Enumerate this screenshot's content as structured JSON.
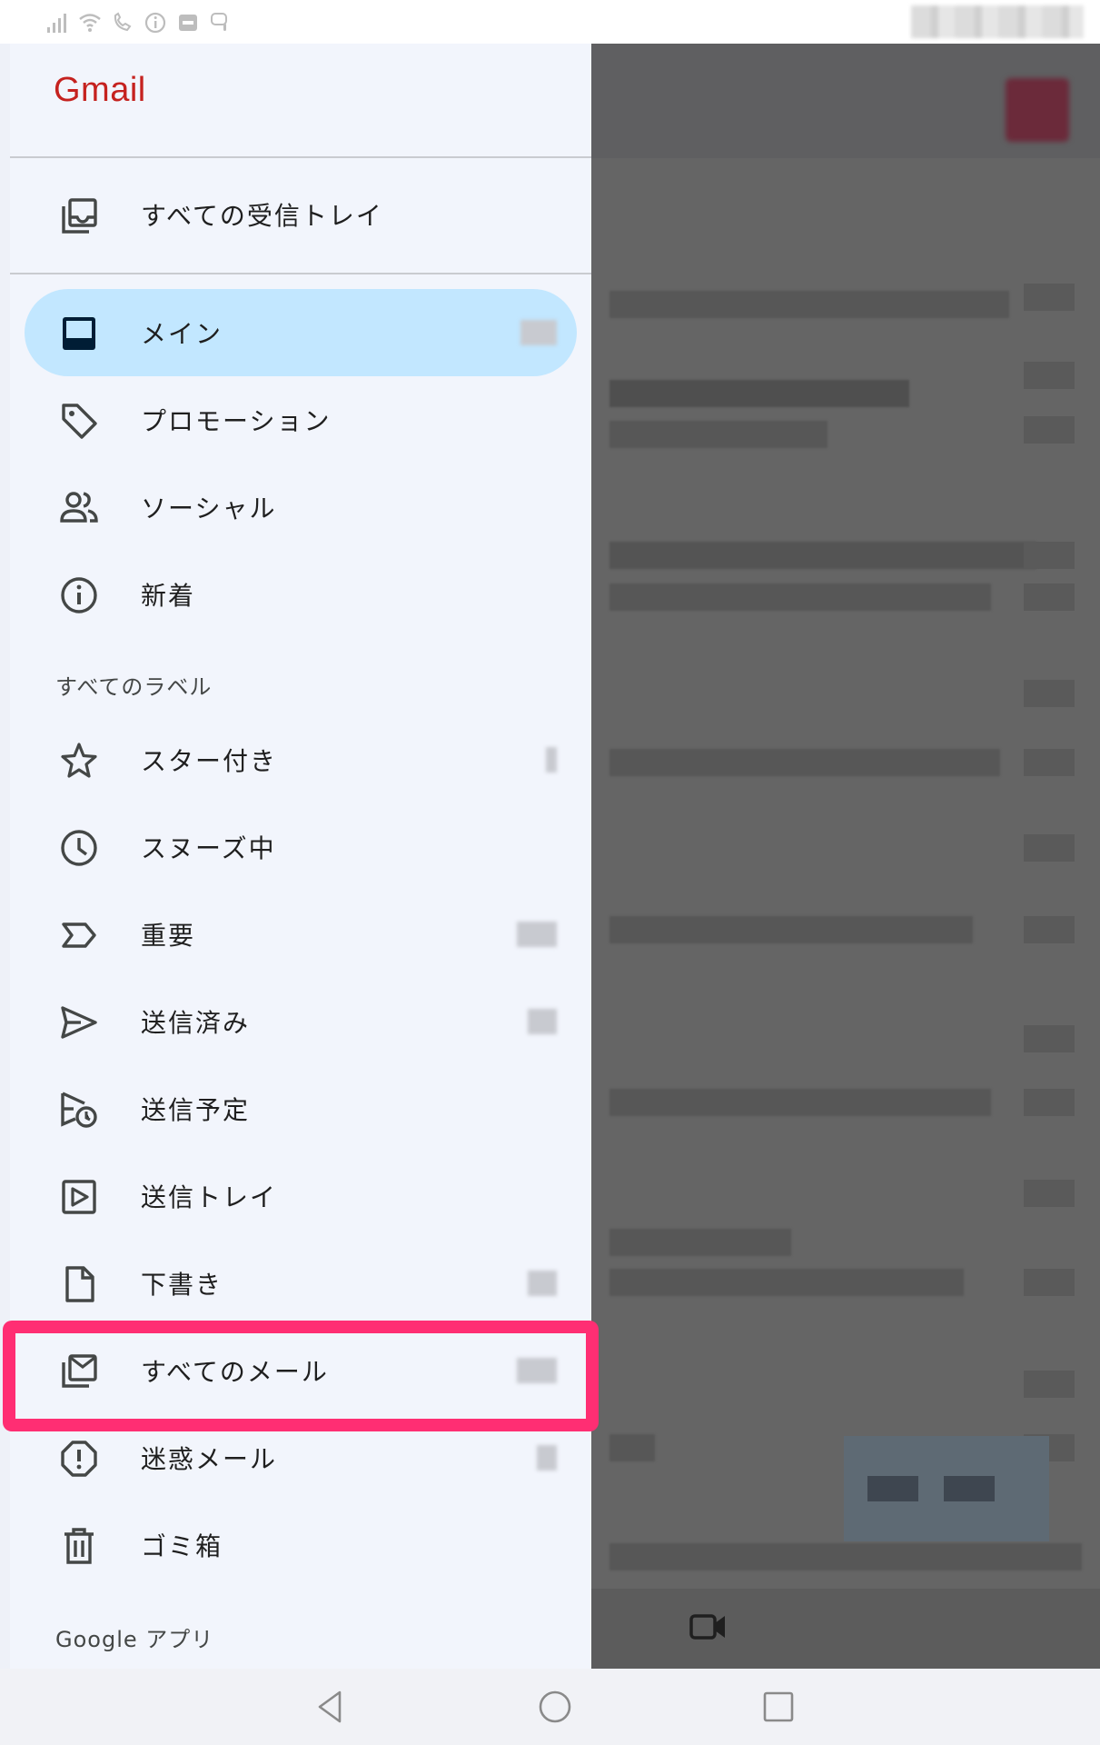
{
  "drawer": {
    "logo": "Gmail",
    "all_inboxes": "すべての受信トレイ",
    "inbox_items": [
      {
        "id": "main",
        "label": "メイン",
        "icon": "inbox-icon"
      },
      {
        "id": "promotions",
        "label": "プロモーション",
        "icon": "tag-icon"
      },
      {
        "id": "social",
        "label": "ソーシャル",
        "icon": "people-icon"
      },
      {
        "id": "updates",
        "label": "新着",
        "icon": "info-icon"
      }
    ],
    "labels_header": "すべてのラベル",
    "label_items": [
      {
        "id": "starred",
        "label": "スター付き",
        "icon": "star-icon"
      },
      {
        "id": "snoozed",
        "label": "スヌーズ中",
        "icon": "clock-icon"
      },
      {
        "id": "important",
        "label": "重要",
        "icon": "important-icon"
      },
      {
        "id": "sent",
        "label": "送信済み",
        "icon": "send-icon"
      },
      {
        "id": "scheduled",
        "label": "送信予定",
        "icon": "scheduled-send-icon"
      },
      {
        "id": "outbox",
        "label": "送信トレイ",
        "icon": "outbox-icon"
      },
      {
        "id": "drafts",
        "label": "下書き",
        "icon": "draft-icon"
      },
      {
        "id": "all_mail",
        "label": "すべてのメール",
        "icon": "all-mail-icon"
      },
      {
        "id": "spam",
        "label": "迷惑メール",
        "icon": "spam-icon"
      },
      {
        "id": "trash",
        "label": "ゴミ箱",
        "icon": "trash-icon"
      }
    ],
    "google_apps_header": "Google アプリ"
  },
  "system_nav": {
    "icons": [
      "back-icon",
      "home-icon",
      "recents-icon"
    ]
  },
  "colors": {
    "logo": "#c5221f",
    "active_bg": "#c2e7ff",
    "highlight": "#ff2e73",
    "drawer_bg": "#f2f5fc",
    "scrim": "#656565"
  }
}
